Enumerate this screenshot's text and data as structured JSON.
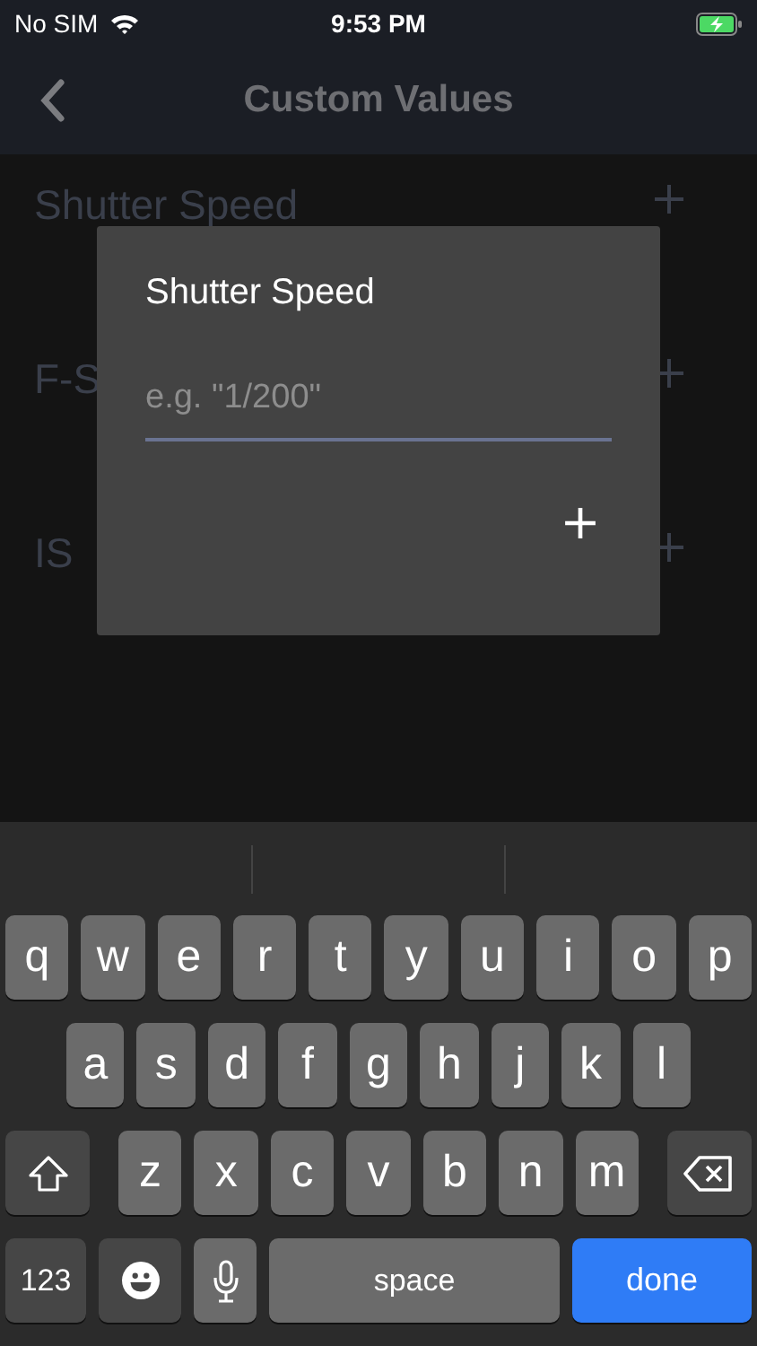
{
  "status_bar": {
    "carrier": "No SIM",
    "time": "9:53 PM",
    "battery_charging": true
  },
  "nav_bar": {
    "title": "Custom Values"
  },
  "list": [
    {
      "label": "Shutter Speed"
    },
    {
      "label": "F-S"
    },
    {
      "label": "IS"
    }
  ],
  "dialog": {
    "title": "Shutter Speed",
    "placeholder": "e.g. \"1/200\""
  },
  "keyboard": {
    "rows": [
      {
        "keys": [
          {
            "kind": "letter",
            "label": "q"
          },
          {
            "kind": "letter",
            "label": "w"
          },
          {
            "kind": "letter",
            "label": "e"
          },
          {
            "kind": "letter",
            "label": "r"
          },
          {
            "kind": "letter",
            "label": "t"
          },
          {
            "kind": "letter",
            "label": "y"
          },
          {
            "kind": "letter",
            "label": "u"
          },
          {
            "kind": "letter",
            "label": "i"
          },
          {
            "kind": "letter",
            "label": "o"
          },
          {
            "kind": "letter",
            "label": "p"
          }
        ]
      },
      {
        "keys": [
          {
            "kind": "letter",
            "label": "a"
          },
          {
            "kind": "letter",
            "label": "s"
          },
          {
            "kind": "letter",
            "label": "d"
          },
          {
            "kind": "letter",
            "label": "f"
          },
          {
            "kind": "letter",
            "label": "g"
          },
          {
            "kind": "letter",
            "label": "h"
          },
          {
            "kind": "letter",
            "label": "j"
          },
          {
            "kind": "letter",
            "label": "k"
          },
          {
            "kind": "letter",
            "label": "l"
          }
        ]
      },
      {
        "keys": [
          {
            "kind": "shift"
          },
          {
            "kind": "letter",
            "label": "z"
          },
          {
            "kind": "letter",
            "label": "x"
          },
          {
            "kind": "letter",
            "label": "c"
          },
          {
            "kind": "letter",
            "label": "v"
          },
          {
            "kind": "letter",
            "label": "b"
          },
          {
            "kind": "letter",
            "label": "n"
          },
          {
            "kind": "letter",
            "label": "m"
          },
          {
            "kind": "backspace"
          }
        ]
      },
      {
        "keys": [
          {
            "kind": "numbers",
            "label": "123"
          },
          {
            "kind": "emoji"
          },
          {
            "kind": "mic"
          },
          {
            "kind": "space",
            "label": "space"
          },
          {
            "kind": "return",
            "label": "done"
          }
        ]
      }
    ]
  }
}
